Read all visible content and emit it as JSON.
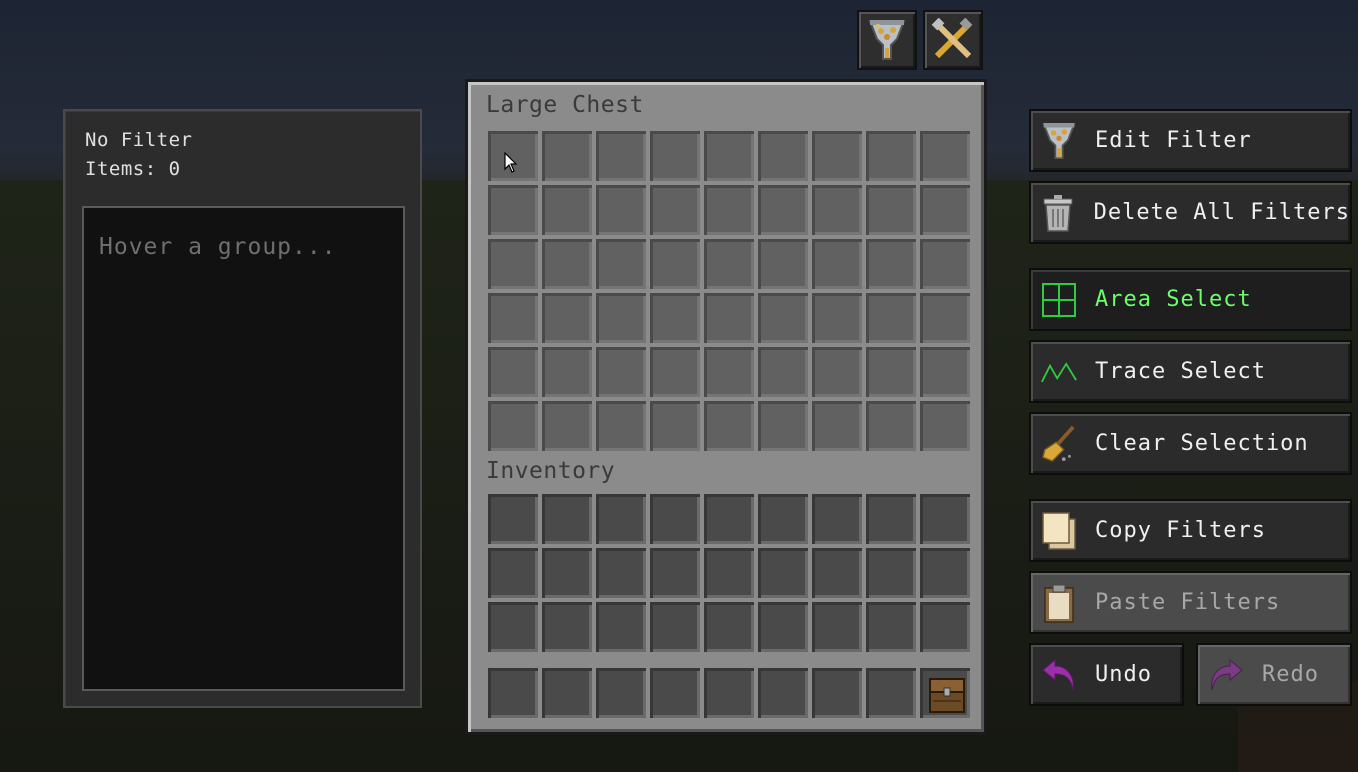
{
  "info_panel": {
    "filter_label": "No Filter",
    "items_label": "Items: 0",
    "hover_placeholder": "Hover a group..."
  },
  "tabs": [
    {
      "icon": "funnel-filter-icon"
    },
    {
      "icon": "crossed-tools-icon"
    }
  ],
  "chest": {
    "title": "Large Chest",
    "rows": 6,
    "cols": 9
  },
  "inventory": {
    "title": "Inventory",
    "rows": 3,
    "cols": 9,
    "hotbar_item_icon": "chest-icon"
  },
  "buttons": {
    "edit_filter": "Edit Filter",
    "delete_all_filters": "Delete All Filters",
    "area_select": "Area Select",
    "trace_select": "Trace Select",
    "clear_selection": "Clear Selection",
    "copy_filters": "Copy Filters",
    "paste_filters": "Paste Filters",
    "undo": "Undo",
    "redo": "Redo"
  },
  "colors": {
    "active_label": "#6bff6b",
    "undo_arrow": "#9b2fa8"
  }
}
